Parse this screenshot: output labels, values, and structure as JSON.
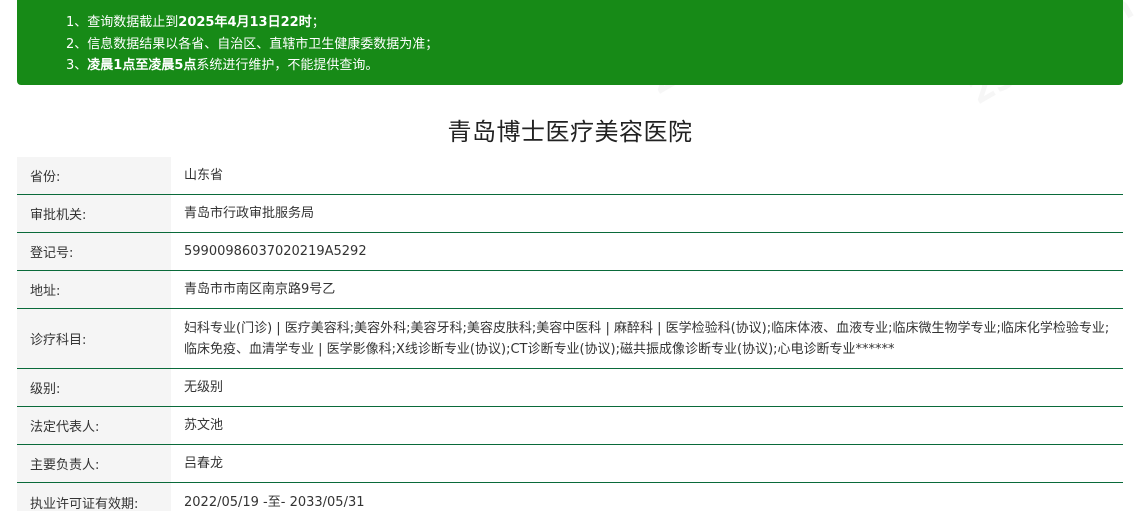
{
  "notice": {
    "lines": [
      {
        "prefix": "1、查询数据截止到",
        "bold": "2025年4月13日22时",
        "suffix": "；"
      },
      {
        "prefix": "2、信息数据结果以各省、自治区、直辖市卫生健康委数据为准；",
        "bold": "",
        "suffix": ""
      },
      {
        "prefix": "3、",
        "bold": "凌晨1点至凌晨5点",
        "suffix": "系统进行维护，不能提供查询。"
      }
    ]
  },
  "title": "青岛博士医疗美容医院",
  "rows": [
    {
      "label": "省份:",
      "value": "山东省"
    },
    {
      "label": "审批机关:",
      "value": "青岛市行政审批服务局"
    },
    {
      "label": "登记号:",
      "value": "59900986037020219A5292"
    },
    {
      "label": "地址:",
      "value": "青岛市市南区南京路9号乙"
    },
    {
      "label": "诊疗科目:",
      "value": "妇科专业(门诊) | 医疗美容科;美容外科;美容牙科;美容皮肤科;美容中医科 | 麻醉科 | 医学检验科(协议);临床体液、血液专业;临床微生物学专业;临床化学检验专业;临床免疫、血清学专业 | 医学影像科;X线诊断专业(协议);CT诊断专业(协议);磁共振成像诊断专业(协议);心电诊断专业******"
    },
    {
      "label": "级别:",
      "value": "无级别"
    },
    {
      "label": "法定代表人:",
      "value": "苏文池"
    },
    {
      "label": "主要负责人:",
      "value": "吕春龙"
    },
    {
      "label": "执业许可证有效期:",
      "value": "2022/05/19 -至- 2033/05/31"
    }
  ],
  "watermark_text": "236z.com"
}
